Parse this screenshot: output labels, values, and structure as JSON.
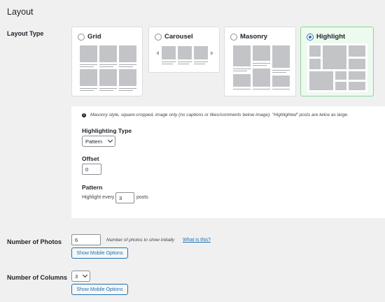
{
  "section": {
    "title": "Layout"
  },
  "layout_type": {
    "label": "Layout Type",
    "options": [
      {
        "label": "Grid",
        "selected": false
      },
      {
        "label": "Carousel",
        "selected": false
      },
      {
        "label": "Masonry",
        "selected": false
      },
      {
        "label": "Highlight",
        "selected": true
      }
    ]
  },
  "settings": {
    "info": "Masonry style, square-cropped, image only (no captions or likes/comments below image). \"Highlighted\" posts are twice as large.",
    "info_icon": "info-icon",
    "highlighting_type": {
      "label": "Highlighting Type",
      "value": "Pattern"
    },
    "offset": {
      "label": "Offset",
      "value": "0"
    },
    "pattern": {
      "label": "Pattern",
      "prefix": "Highlight every",
      "value": "3",
      "suffix": "posts"
    }
  },
  "num_photos": {
    "label": "Number of Photos",
    "value": "6",
    "help": "Number of photos to show initially",
    "link": "What is this?",
    "button": "Show Mobile Options"
  },
  "num_columns": {
    "label": "Number of Columns",
    "value": "3",
    "button": "Show Mobile Options"
  },
  "colors": {
    "accent": "#2271b1",
    "active_card_bg": "#edfaef",
    "active_card_border": "#8fd39a",
    "page_bg": "#f0f0f1"
  }
}
